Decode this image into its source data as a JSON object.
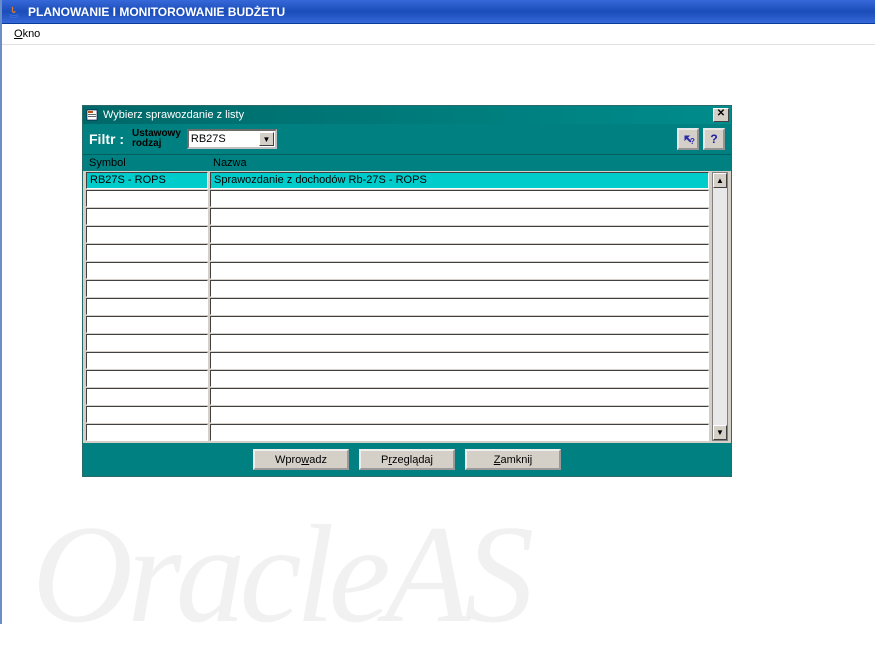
{
  "outer": {
    "title": "PLANOWANIE I MONITOROWANIE BUDŻETU"
  },
  "menu": {
    "okno_prefix": "O",
    "okno_rest": "kno"
  },
  "dialog": {
    "title": "Wybierz sprawozdanie z listy",
    "close_glyph": "✕"
  },
  "filter": {
    "label": "Filtr :",
    "sublabel_line1": "Ustawowy",
    "sublabel_line2": "rodzaj",
    "selected": "RB27S",
    "dd_glyph": "▼"
  },
  "help": {
    "glyph1": "❖?",
    "glyph2": "?"
  },
  "grid": {
    "header_symbol": "Symbol",
    "header_nazwa": "Nazwa",
    "rows": [
      {
        "symbol": "RB27S - ROPS",
        "nazwa": "Sprawozdanie z dochodów Rb-27S - ROPS",
        "selected": true
      },
      {
        "symbol": "",
        "nazwa": ""
      },
      {
        "symbol": "",
        "nazwa": ""
      },
      {
        "symbol": "",
        "nazwa": ""
      },
      {
        "symbol": "",
        "nazwa": ""
      },
      {
        "symbol": "",
        "nazwa": ""
      },
      {
        "symbol": "",
        "nazwa": ""
      },
      {
        "symbol": "",
        "nazwa": ""
      },
      {
        "symbol": "",
        "nazwa": ""
      },
      {
        "symbol": "",
        "nazwa": ""
      },
      {
        "symbol": "",
        "nazwa": ""
      },
      {
        "symbol": "",
        "nazwa": ""
      },
      {
        "symbol": "",
        "nazwa": ""
      },
      {
        "symbol": "",
        "nazwa": ""
      },
      {
        "symbol": "",
        "nazwa": ""
      }
    ],
    "scroll_up": "▲",
    "scroll_down": "▼"
  },
  "buttons": {
    "wprowadz_ul": "w",
    "wprowadz_pre": "Wpro",
    "wprowadz_post": "adz",
    "przegladaj_ul": "r",
    "przegladaj_pre": "P",
    "przegladaj_post": "zeglądaj",
    "zamknij_ul": "Z",
    "zamknij_post": "amknij"
  },
  "watermark": "OracleAS"
}
